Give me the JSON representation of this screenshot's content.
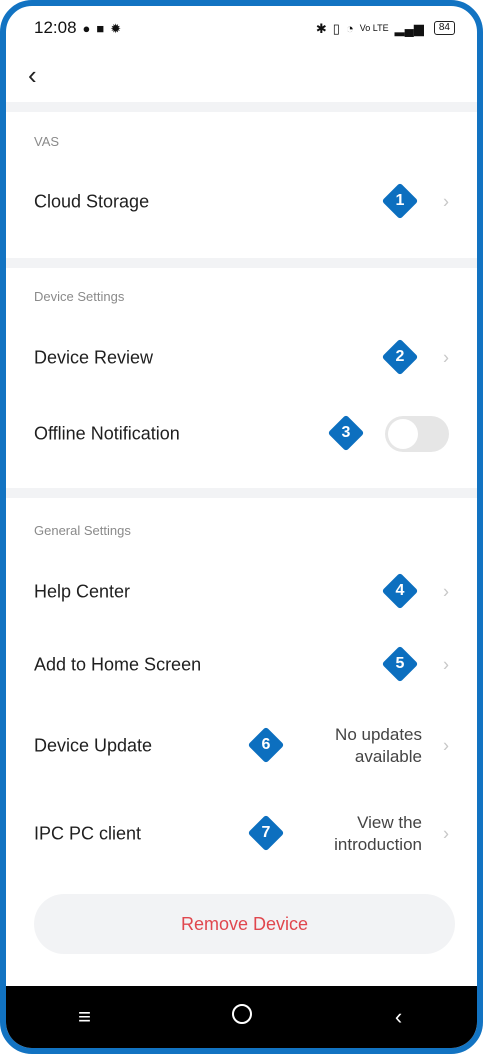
{
  "status_bar": {
    "time": "12:08",
    "battery": "84",
    "network": "Vo LTE",
    "left_icons": [
      "chat-icon",
      "app-icon",
      "settings-icon"
    ],
    "right_icons": [
      "bluetooth-icon",
      "vibrate-icon",
      "wifi-icon",
      "signal-icon",
      "battery-icon"
    ]
  },
  "header": {
    "back_icon": "back-arrow-icon"
  },
  "sections": {
    "vas": {
      "title": "VAS",
      "items": [
        {
          "label": "Cloud Storage",
          "badge": "1"
        }
      ]
    },
    "device_settings": {
      "title": "Device Settings",
      "items": [
        {
          "label": "Device Review",
          "badge": "2"
        },
        {
          "label": "Offline Notification",
          "badge": "3",
          "toggle": false
        }
      ]
    },
    "general_settings": {
      "title": "General Settings",
      "items": [
        {
          "label": "Help Center",
          "badge": "4"
        },
        {
          "label": "Add to Home Screen",
          "badge": "5"
        },
        {
          "label": "Device Update",
          "badge": "6",
          "value_line1": "No updates",
          "value_line2": "available"
        },
        {
          "label": "IPC PC client",
          "badge": "7",
          "value_line1": "View the",
          "value_line2": "introduction"
        }
      ]
    }
  },
  "remove_button": "Remove Device",
  "colors": {
    "badge": "#0c6fbf",
    "remove_text": "#e0474e",
    "frame": "#1273c2"
  },
  "nav_bar": {
    "icons": [
      "menu-icon",
      "home-icon",
      "back-icon"
    ]
  }
}
